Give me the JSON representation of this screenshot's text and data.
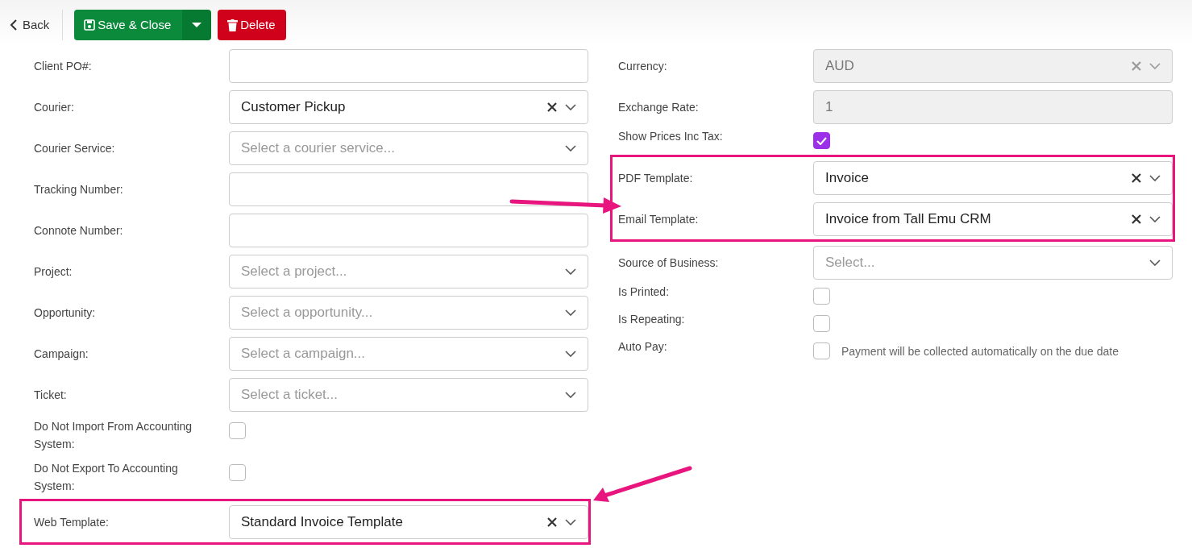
{
  "toolbar": {
    "back": "Back",
    "save": "Save & Close",
    "delete": "Delete"
  },
  "left_fields": [
    {
      "kind": "input",
      "label": "Client PO#:",
      "disabled": false,
      "highlighted": false
    },
    {
      "kind": "select",
      "label": "Courier:",
      "value": "Customer Pickup",
      "clearable": true,
      "disabled": false,
      "highlighted": false
    },
    {
      "kind": "select",
      "label": "Courier Service:",
      "placeholder": "Select a courier service...",
      "clearable": false,
      "disabled": false,
      "highlighted": false
    },
    {
      "kind": "input",
      "label": "Tracking Number:",
      "disabled": false,
      "highlighted": false
    },
    {
      "kind": "input",
      "label": "Connote Number:",
      "disabled": false,
      "highlighted": false
    },
    {
      "kind": "select",
      "label": "Project:",
      "placeholder": "Select a project...",
      "clearable": false,
      "disabled": false,
      "highlighted": false
    },
    {
      "kind": "select",
      "label": "Opportunity:",
      "placeholder": "Select a opportunity...",
      "clearable": false,
      "disabled": false,
      "highlighted": false
    },
    {
      "kind": "select",
      "label": "Campaign:",
      "placeholder": "Select a campaign...",
      "clearable": false,
      "disabled": false,
      "highlighted": false
    },
    {
      "kind": "select",
      "label": "Ticket:",
      "placeholder": "Select a ticket...",
      "clearable": false,
      "disabled": false,
      "highlighted": false
    },
    {
      "kind": "checkbox",
      "label": "Do Not Import From Accounting System:",
      "checked": false,
      "highlighted": false
    },
    {
      "kind": "checkbox",
      "label": "Do Not Export To Accounting System:",
      "checked": false,
      "highlighted": false
    },
    {
      "kind": "select",
      "label": "Web Template:",
      "value": "Standard Invoice Template",
      "clearable": true,
      "disabled": false,
      "highlighted": true
    }
  ],
  "right_fields": [
    {
      "kind": "select",
      "label": "Currency:",
      "value": "AUD",
      "clearable": true,
      "disabled": true,
      "highlighted": false
    },
    {
      "kind": "input",
      "label": "Exchange Rate:",
      "value": "1",
      "disabled": true,
      "highlighted": false
    },
    {
      "kind": "checkbox",
      "label": "Show Prices Inc Tax:",
      "checked": true,
      "highlighted": false
    },
    {
      "kind": "select",
      "label": "PDF Template:",
      "value": "Invoice",
      "clearable": true,
      "disabled": false,
      "highlighted": true
    },
    {
      "kind": "select",
      "label": "Email Template:",
      "value": "Invoice from Tall Emu CRM",
      "clearable": true,
      "disabled": false,
      "highlighted": true
    },
    {
      "kind": "select",
      "label": "Source of Business:",
      "placeholder": "Select...",
      "clearable": false,
      "disabled": false,
      "highlighted": false
    },
    {
      "kind": "checkbox",
      "label": "Is Printed:",
      "checked": false,
      "highlighted": false
    },
    {
      "kind": "checkbox",
      "label": "Is Repeating:",
      "checked": false,
      "highlighted": false
    },
    {
      "kind": "checkbox",
      "label": "Auto Pay:",
      "checked": false,
      "note": "Payment will be collected automatically on the due date",
      "highlighted": false
    }
  ]
}
